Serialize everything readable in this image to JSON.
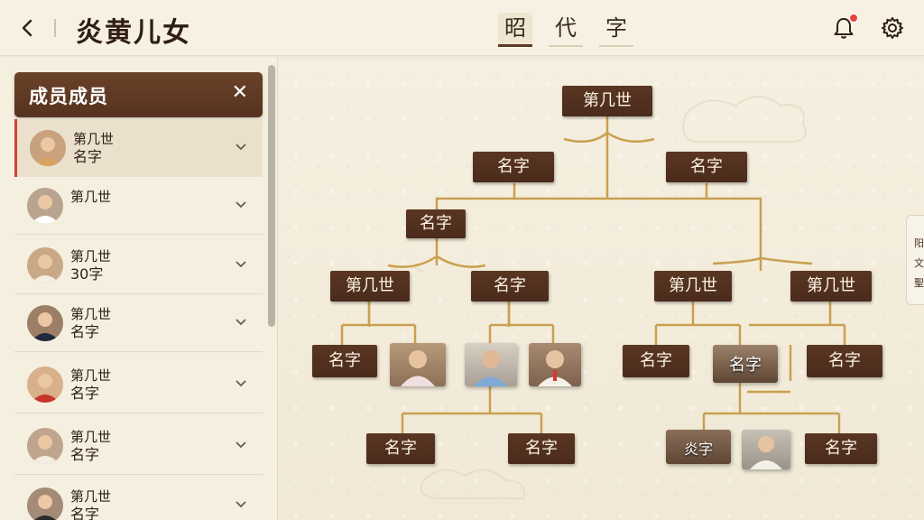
{
  "header": {
    "title": "炎黄儿女",
    "tabs": [
      "昭",
      "代",
      "字"
    ],
    "active_tab": 0,
    "notification_count": "1"
  },
  "panel": {
    "title": "成员成员",
    "members": [
      {
        "line1": "第几世",
        "line2": "名字",
        "selected": true
      },
      {
        "line1": "第几世",
        "line2": ""
      },
      {
        "line1": "第几世",
        "line2": "30字"
      },
      {
        "line1": "第几世",
        "line2": "名字"
      },
      {
        "line1": "第几世",
        "line2": "名字"
      },
      {
        "line1": "第几世",
        "line2": "名字"
      },
      {
        "line1": "第几世",
        "line2": "名字"
      }
    ]
  },
  "tree": {
    "root": "第几世",
    "labels": {
      "n1": "名字",
      "n2": "名字",
      "n3": "名字",
      "g3a": "第几世",
      "g3b": "名字",
      "g3c": "第几世",
      "g3d": "第几世",
      "l1": "名字",
      "l5": "名字",
      "l6": "名字",
      "l7": "名字",
      "b1": "名字",
      "b2": "名字",
      "b3": "炎字",
      "b5": "名字"
    }
  },
  "sidetab": {
    "chars": [
      "阳",
      "文",
      "聖"
    ]
  },
  "colors": {
    "accent": "#5a3623",
    "alert": "#e8433b",
    "line": "#c9a050"
  }
}
